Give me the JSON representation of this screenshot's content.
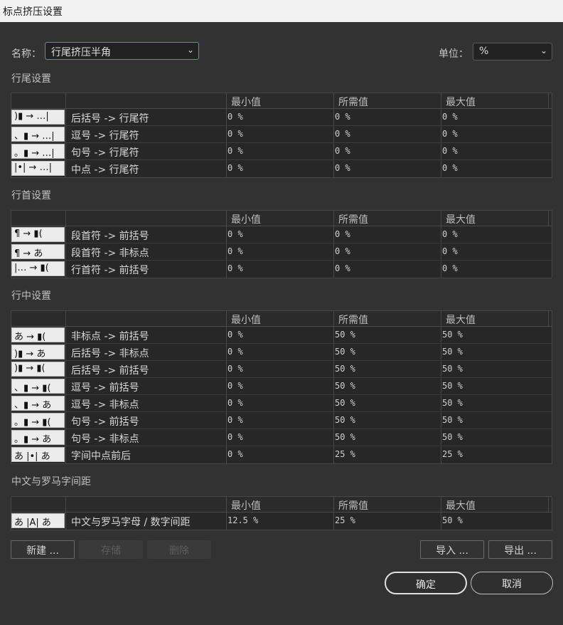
{
  "window": {
    "title": "标点挤压设置"
  },
  "name_field": {
    "label": "名称：",
    "value": "行尾挤压半角"
  },
  "unit_field": {
    "label": "单位：",
    "value": "%"
  },
  "columns": {
    "min": "最小值",
    "desired": "所需值",
    "max": "最大值"
  },
  "sections": [
    {
      "title": "行尾设置",
      "rows": [
        {
          "icon": ")▮ → …|",
          "name": "后括号 -> 行尾符",
          "min": "0 %",
          "desired": "0 %",
          "max": "0 %"
        },
        {
          "icon": "、▮ → …|",
          "name": "逗号 -> 行尾符",
          "min": "0 %",
          "desired": "0 %",
          "max": "0 %"
        },
        {
          "icon": "。▮ → …|",
          "name": "句号 -> 行尾符",
          "min": "0 %",
          "desired": "0 %",
          "max": "0 %"
        },
        {
          "icon": "|•| → …|",
          "name": "中点 -> 行尾符",
          "min": "0 %",
          "desired": "0 %",
          "max": "0 %"
        }
      ]
    },
    {
      "title": "行首设置",
      "rows": [
        {
          "icon": "¶ → ▮(",
          "name": "段首符 -> 前括号",
          "min": "0 %",
          "desired": "0 %",
          "max": "0 %"
        },
        {
          "icon": "¶ → あ",
          "name": "段首符 -> 非标点",
          "min": "0 %",
          "desired": "0 %",
          "max": "0 %"
        },
        {
          "icon": "|… → ▮(",
          "name": "行首符 -> 前括号",
          "min": "0 %",
          "desired": "0 %",
          "max": "0 %"
        }
      ]
    },
    {
      "title": "行中设置",
      "rows": [
        {
          "icon": "あ → ▮(",
          "name": "非标点 -> 前括号",
          "min": "0 %",
          "desired": "50 %",
          "max": "50 %"
        },
        {
          "icon": ")▮ → あ",
          "name": "后括号 -> 非标点",
          "min": "0 %",
          "desired": "50 %",
          "max": "50 %"
        },
        {
          "icon": ")▮ → ▮(",
          "name": "后括号 -> 前括号",
          "min": "0 %",
          "desired": "50 %",
          "max": "50 %"
        },
        {
          "icon": "、▮ → ▮(",
          "name": "逗号 -> 前括号",
          "min": "0 %",
          "desired": "50 %",
          "max": "50 %"
        },
        {
          "icon": "、▮ → あ",
          "name": "逗号 -> 非标点",
          "min": "0 %",
          "desired": "50 %",
          "max": "50 %"
        },
        {
          "icon": "。▮ → ▮(",
          "name": "句号 -> 前括号",
          "min": "0 %",
          "desired": "50 %",
          "max": "50 %"
        },
        {
          "icon": "。▮ → あ",
          "name": "句号 -> 非标点",
          "min": "0 %",
          "desired": "50 %",
          "max": "50 %"
        },
        {
          "icon": "あ |•| あ",
          "name": "字间中点前后",
          "min": "0 %",
          "desired": "25 %",
          "max": "25 %"
        }
      ]
    },
    {
      "title": "中文与罗马字间距",
      "rows": [
        {
          "icon": "あ |A| あ",
          "name": "中文与罗马字母 / 数字间距",
          "min": "12.5 %",
          "desired": "25 %",
          "max": "50 %"
        }
      ]
    }
  ],
  "buttons": {
    "new": "新建 ...",
    "save": "存储",
    "delete": "删除",
    "import": "导入 ...",
    "export": "导出 ...",
    "ok": "确定",
    "cancel": "取消"
  },
  "icons": {
    "dropdown": "chevron-down-icon"
  }
}
